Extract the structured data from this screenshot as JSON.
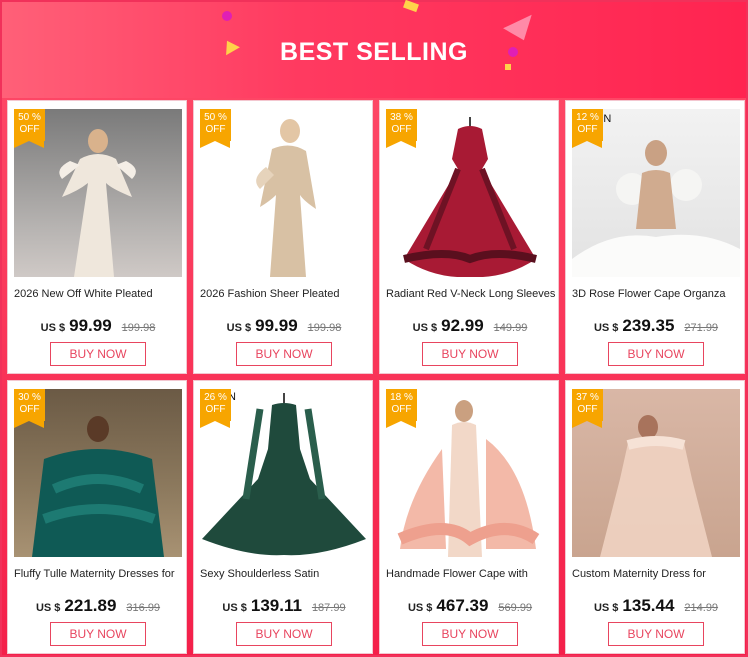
{
  "header": {
    "title": "BEST SELLING"
  },
  "colors": {
    "accent": "#f4204a",
    "badge": "#f7a500",
    "button": "#e8455f"
  },
  "products": [
    {
      "discount": "50 %",
      "off": "OFF",
      "name": "2026 New Off White Pleated",
      "currency": "US $",
      "price": "99.99",
      "old_price": "199.98",
      "button": "BUY NOW",
      "stray": ""
    },
    {
      "discount": "50 %",
      "off": "OFF",
      "name": "2026 Fashion Sheer Pleated",
      "currency": "US $",
      "price": "99.99",
      "old_price": "199.98",
      "button": "BUY NOW",
      "stray": ""
    },
    {
      "discount": "38 %",
      "off": "OFF",
      "name": "Radiant Red V-Neck Long Sleeves",
      "currency": "US $",
      "price": "92.99",
      "old_price": "149.99",
      "button": "BUY NOW",
      "stray": ""
    },
    {
      "discount": "12 %",
      "off": "OFF",
      "name": "3D Rose Flower Cape Organza",
      "currency": "US $",
      "price": "239.35",
      "old_price": "271.99",
      "button": "BUY NOW",
      "stray": "EN"
    },
    {
      "discount": "30 %",
      "off": "OFF",
      "name": "Fluffy Tulle Maternity Dresses for",
      "currency": "US $",
      "price": "221.89",
      "old_price": "316.99",
      "button": "BUY NOW",
      "stray": ""
    },
    {
      "discount": "26 %",
      "off": "OFF",
      "name": "Sexy Shoulderless Satin",
      "currency": "US $",
      "price": "139.11",
      "old_price": "187.99",
      "button": "BUY NOW",
      "stray": "N"
    },
    {
      "discount": "18 %",
      "off": "OFF",
      "name": "Handmade Flower Cape with",
      "currency": "US $",
      "price": "467.39",
      "old_price": "569.99",
      "button": "BUY NOW",
      "stray": ""
    },
    {
      "discount": "37 %",
      "off": "OFF",
      "name": "Custom Maternity Dress for",
      "currency": "US $",
      "price": "135.44",
      "old_price": "214.99",
      "button": "BUY NOW",
      "stray": ""
    }
  ]
}
